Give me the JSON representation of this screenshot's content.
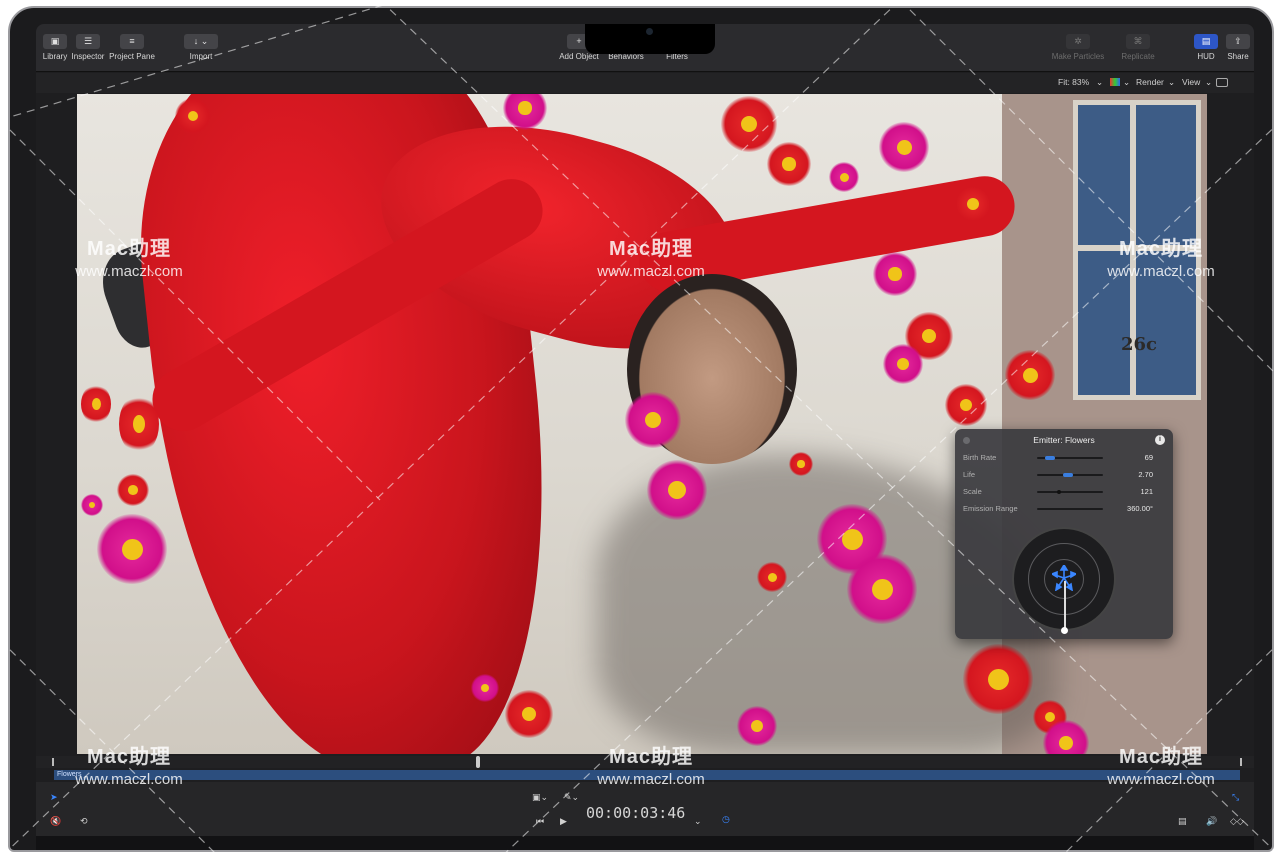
{
  "toolbar": {
    "library": "Library",
    "inspector": "Inspector",
    "project_pane": "Project Pane",
    "import": "Import",
    "add_object": "Add Object",
    "behaviors": "Behaviors",
    "filters": "Filters",
    "make_particles": "Make Particles",
    "replicate": "Replicate",
    "hud": "HUD",
    "share": "Share"
  },
  "viewer": {
    "fit": "Fit: 83%",
    "render": "Render",
    "view": "View"
  },
  "hud_panel": {
    "title": "Emitter: Flowers",
    "info": "i",
    "params": [
      {
        "label": "Birth Rate",
        "value": "69",
        "level": 0.12
      },
      {
        "label": "Life",
        "value": "2.70",
        "level": 0.4
      },
      {
        "label": "Scale",
        "value": "121",
        "level": 0.3
      },
      {
        "label": "Emission Range",
        "value": "360.00°",
        "level": 1.0
      }
    ]
  },
  "scene": {
    "sign_text": "26c"
  },
  "timeline": {
    "track_label": "Flowers",
    "timecode": "00:00:03:46"
  },
  "watermark": {
    "line1": "Mac助理",
    "line2": "www.maczl.com"
  },
  "colors": {
    "accent": "#2d56c7",
    "track": "#2c4e7e",
    "dress_red": "#d4161f",
    "flower_pink": "#d10f8a"
  }
}
